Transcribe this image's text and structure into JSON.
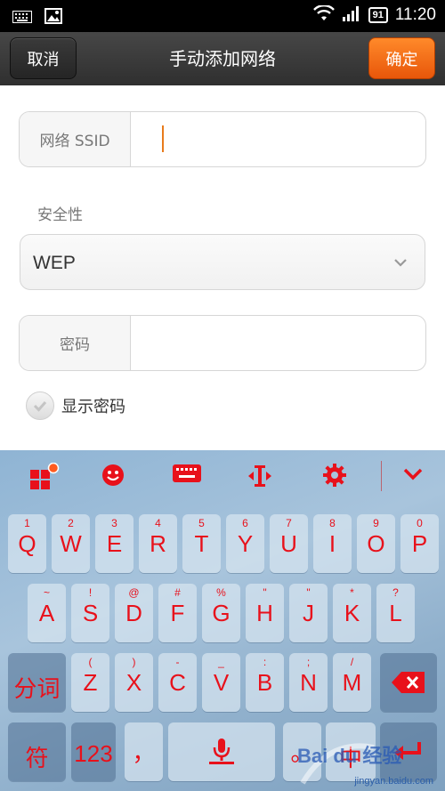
{
  "status_bar": {
    "time": "11:20",
    "battery": "91"
  },
  "title_bar": {
    "cancel": "取消",
    "title": "手动添加网络",
    "confirm": "确定"
  },
  "form": {
    "ssid_label": "网络 SSID",
    "ssid_value": "",
    "security_label": "安全性",
    "security_value": "WEP",
    "password_label": "密码",
    "password_value": "",
    "show_password_label": "显示密码"
  },
  "keyboard": {
    "row1": [
      {
        "main": "Q",
        "sub": "1"
      },
      {
        "main": "W",
        "sub": "2"
      },
      {
        "main": "E",
        "sub": "3"
      },
      {
        "main": "R",
        "sub": "4"
      },
      {
        "main": "T",
        "sub": "5"
      },
      {
        "main": "Y",
        "sub": "6"
      },
      {
        "main": "U",
        "sub": "7"
      },
      {
        "main": "I",
        "sub": "8"
      },
      {
        "main": "O",
        "sub": "9"
      },
      {
        "main": "P",
        "sub": "0"
      }
    ],
    "row2": [
      {
        "main": "A",
        "sub": "~"
      },
      {
        "main": "S",
        "sub": "!"
      },
      {
        "main": "D",
        "sub": "@"
      },
      {
        "main": "F",
        "sub": "#"
      },
      {
        "main": "G",
        "sub": "%"
      },
      {
        "main": "H",
        "sub": "\""
      },
      {
        "main": "J",
        "sub": "\""
      },
      {
        "main": "K",
        "sub": "*"
      },
      {
        "main": "L",
        "sub": "?"
      }
    ],
    "row3_left": "分词",
    "row3": [
      {
        "main": "Z",
        "sub": "("
      },
      {
        "main": "X",
        "sub": ")"
      },
      {
        "main": "C",
        "sub": "-"
      },
      {
        "main": "V",
        "sub": "_"
      },
      {
        "main": "B",
        "sub": ":"
      },
      {
        "main": "N",
        "sub": ";"
      },
      {
        "main": "M",
        "sub": "/"
      }
    ],
    "row4": {
      "symbols": "符",
      "numbers": "123",
      "comma": "，",
      "period": "。",
      "lang": "中"
    }
  },
  "watermark": {
    "brand": "Bai du 经验",
    "url": "jingyan.baidu.com"
  },
  "colors": {
    "accent_orange": "#e8560a",
    "key_text_red": "#e8111b"
  }
}
